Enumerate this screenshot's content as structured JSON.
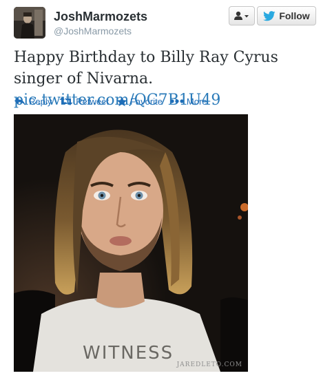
{
  "header": {
    "display_name": "JoshMarmozets",
    "handle": "@JoshMarmozets",
    "follow_label": "Follow"
  },
  "tweet": {
    "text": "Happy Birthday to Billy Ray Cyrus singer of Nivarna.",
    "link": "pic.twitter.com/QC7B1U49"
  },
  "actions": [
    {
      "label": "Reply",
      "icon": "reply-icon"
    },
    {
      "label": "Retweet",
      "icon": "retweet-icon"
    },
    {
      "label": "Favorite",
      "icon": "star-icon"
    },
    {
      "label": "More",
      "icon": "more-dots-icon"
    }
  ],
  "photo": {
    "shirt_text": "WITNESS",
    "watermark": "JAREDLETO.COM"
  },
  "colors": {
    "link": "#2b7bb9",
    "action_blue": "#1f6eb8",
    "twitter_bird": "#2aa9e0",
    "name": "#292f33",
    "handle": "#8899a6"
  }
}
